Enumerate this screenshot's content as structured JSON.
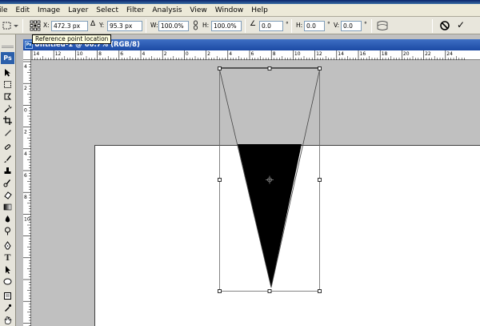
{
  "menu": {
    "items": [
      "ile",
      "Edit",
      "Image",
      "Layer",
      "Select",
      "Filter",
      "Analysis",
      "View",
      "Window",
      "Help"
    ]
  },
  "options_bar": {
    "x_label": "X:",
    "x_value": "472.3 px",
    "y_label": "Y:",
    "y_value": "95.3 px",
    "w_label": "W:",
    "w_value": "100.0%",
    "h_label": "H:",
    "h_value": "100.0%",
    "rotate_value": "0.0",
    "hskew_label": "H:",
    "hskew_value": "0.0",
    "vskew_label": "V:",
    "vskew_value": "0.0",
    "delta_glyph": "Δ",
    "angle_glyph": "∠",
    "cancel_glyph": "⃠",
    "commit_glyph": "✓"
  },
  "tooltip": {
    "text": "Reference point location"
  },
  "toolbox": {
    "logo": "Ps",
    "type_tool": "T"
  },
  "document": {
    "title": "Untitled-1 @ 66.7% (RGB/8)",
    "icon": "Ps"
  },
  "ruler": {
    "top_labels": [
      "14",
      "12",
      "10",
      "8",
      "6",
      "4",
      "2",
      "0",
      "2",
      "4",
      "6",
      "8",
      "10",
      "12",
      "14",
      "16",
      "18",
      "20",
      "22",
      "24"
    ],
    "left_labels": [
      "4",
      "2",
      "0",
      "2",
      "4",
      "6",
      "8",
      "10"
    ]
  },
  "colors": {
    "menubar": "#ece9d8",
    "title_bar": "#1c4aa4",
    "canvas_bg": "#c0c0c0",
    "shape_fill": "#000000"
  }
}
